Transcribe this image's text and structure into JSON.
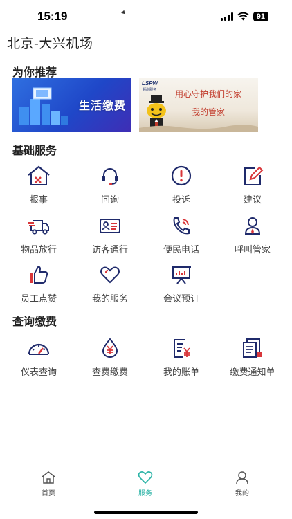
{
  "status_bar": {
    "time": "15:19",
    "battery": "91"
  },
  "header": {
    "location": "北京-大兴机场"
  },
  "recommend": {
    "title": "为你推荐",
    "banners": [
      {
        "text": "生活缴费"
      },
      {
        "logo": "LSPW",
        "logo_sub": "领尚服务",
        "line1": "用心守护我们的家",
        "line2": "我的管家"
      }
    ]
  },
  "basic_services": {
    "title": "基础服务",
    "items": [
      {
        "label": "报事",
        "icon": "house-repair-icon"
      },
      {
        "label": "问询",
        "icon": "headset-icon"
      },
      {
        "label": "投诉",
        "icon": "alert-circle-icon"
      },
      {
        "label": "建议",
        "icon": "edit-icon"
      },
      {
        "label": "物品放行",
        "icon": "truck-icon"
      },
      {
        "label": "访客通行",
        "icon": "id-card-icon"
      },
      {
        "label": "便民电话",
        "icon": "phone-icon"
      },
      {
        "label": "呼叫管家",
        "icon": "butler-icon"
      },
      {
        "label": "员工点赞",
        "icon": "thumbs-up-icon"
      },
      {
        "label": "我的服务",
        "icon": "heart-icon"
      },
      {
        "label": "会议预订",
        "icon": "presentation-icon"
      }
    ]
  },
  "query_payment": {
    "title": "查询缴费",
    "items": [
      {
        "label": "仪表查询",
        "icon": "gauge-icon"
      },
      {
        "label": "查费缴费",
        "icon": "drop-yen-icon"
      },
      {
        "label": "我的账单",
        "icon": "bill-icon"
      },
      {
        "label": "缴费通知单",
        "icon": "notice-icon"
      }
    ]
  },
  "tabbar": {
    "tabs": [
      {
        "label": "首页",
        "icon": "home-icon"
      },
      {
        "label": "服务",
        "icon": "heart-icon",
        "active": true
      },
      {
        "label": "我的",
        "icon": "user-icon"
      }
    ]
  },
  "colors": {
    "icon_navy": "#1f2a6b",
    "icon_red": "#d8363a",
    "accent_teal": "#2bb3a6"
  }
}
